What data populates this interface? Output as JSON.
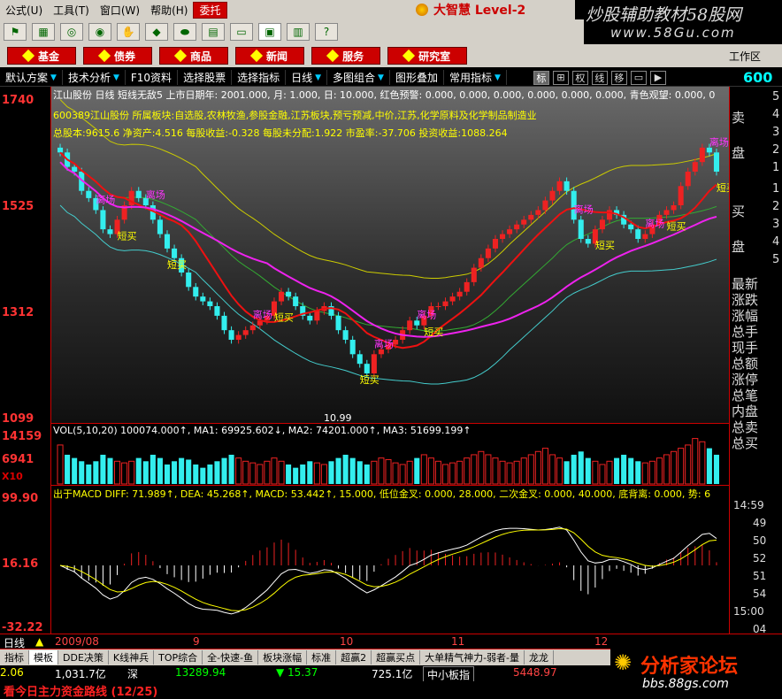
{
  "menu": {
    "items": [
      "公式(U)",
      "工具(T)",
      "窗口(W)",
      "帮助(H)",
      "委托"
    ]
  },
  "brand": {
    "name": "大智慧 Level-2"
  },
  "watermark": {
    "line1": "炒股辅助教材58股网",
    "line2": "www.58Gu.com"
  },
  "nav": {
    "buttons": [
      "基金",
      "债券",
      "商品",
      "新闻",
      "服务",
      "研究室"
    ],
    "workarea": "工作区"
  },
  "funcbar": {
    "items": [
      "默认方案",
      "技术分析",
      "F10资料",
      "选择股票",
      "选择指标",
      "日线",
      "多图组合",
      "图形叠加",
      "常用指标"
    ],
    "keys": [
      "标",
      "⊞",
      "权",
      "线",
      "移",
      "▭",
      "▶"
    ],
    "price": "600"
  },
  "chart": {
    "header": "江山股份 日线 短线无敌5  上市日期年: 2001.000, 月: 1.000, 日: 10.000, 红色预警: 0.000, 0.000, 0.000, 0.000, 0.000, 0.000, 青色观望: 0.000, 0",
    "info1": "600389江山股份 所属板块:自选股,农林牧渔,参股金融,江苏板块,预亏预减,中价,江苏,化学原料及化学制品制造业",
    "info2": "总股本:9615.6 净资产:4.516 每股收益:-0.328 每股未分配:1.922 市盈率:-37.706 投资收益:1088.264",
    "y_labels": [
      "1740",
      "1525",
      "1312",
      "1099"
    ],
    "low_label": "10.99",
    "signal_buy": "短买",
    "signal_sell": "离场"
  },
  "volume": {
    "header": "VOL(5,10,20)  100074.000↑, MA1: 69925.602↓, MA2: 74201.000↑, MA3: 51699.199↑",
    "y_labels": [
      "14159",
      "6941"
    ],
    "unit": "X10"
  },
  "macd": {
    "header": "出于MACD  DIFF: 71.989↑, DEA: 45.268↑, MACD: 53.442↑, 15.000, 低位金叉: 0.000, 28.000, 二次金叉: 0.000, 40.000, 底背离: 0.000, 势: 6",
    "y_labels": [
      "99.90",
      "16.16",
      "-32.22"
    ]
  },
  "right": {
    "sell": [
      "卖",
      "盘"
    ],
    "buy": [
      "买",
      "盘"
    ],
    "sell_nums": [
      "5",
      "4",
      "3",
      "2",
      "1"
    ],
    "buy_nums": [
      "1",
      "2",
      "3",
      "4",
      "5"
    ],
    "stats": [
      "最新",
      "涨跌",
      "涨幅",
      "总手",
      "现手",
      "总额",
      "涨停",
      "总笔",
      "内盘",
      "总卖",
      "总买"
    ],
    "times": [
      "14:59",
      "49",
      "50",
      "52",
      "51",
      "54",
      "15:00",
      "04"
    ]
  },
  "timeaxis": {
    "label": "日线",
    "ticks": [
      "2009/08",
      "9",
      "10",
      "11",
      "12"
    ]
  },
  "tabs": [
    "指标",
    "模板",
    "DDE决策",
    "K线神兵",
    "TOP综合",
    "全-快速-鱼",
    "板块涨幅",
    "标准",
    "超赢2",
    "超赢买点",
    "大单精气神力-弱者-量",
    "龙龙"
  ],
  "status": {
    "v1": "2.06",
    "v2": "1,031.7亿",
    "v3": "深",
    "v4": "13289.94",
    "v5": "▼ 15.37",
    "v6": "725.1亿",
    "v7": "中小板指",
    "v8": "5448.97"
  },
  "ticker": "看今日主力资金路线 (12/25)",
  "forum": {
    "name": "分析家论坛",
    "url": "bbs.88gs.com"
  },
  "chart_data": {
    "type": "candlestick",
    "ylim": [
      1099,
      1740
    ],
    "close": [
      1640,
      1610,
      1600,
      1560,
      1545,
      1520,
      1480,
      1470,
      1500,
      1530,
      1560,
      1545,
      1530,
      1500,
      1470,
      1440,
      1420,
      1390,
      1360,
      1340,
      1330,
      1320,
      1300,
      1270,
      1250,
      1260,
      1270,
      1280,
      1290,
      1300,
      1330,
      1350,
      1340,
      1320,
      1300,
      1290,
      1310,
      1320,
      1300,
      1270,
      1250,
      1220,
      1200,
      1180,
      1220,
      1230,
      1240,
      1250,
      1270,
      1290,
      1280,
      1300,
      1320,
      1320,
      1330,
      1340,
      1350,
      1370,
      1400,
      1420,
      1440,
      1460,
      1470,
      1480,
      1490,
      1500,
      1510,
      1520,
      1540,
      1560,
      1580,
      1560,
      1500,
      1460,
      1450,
      1480,
      1500,
      1520,
      1510,
      1490,
      1480,
      1460,
      1470,
      1490,
      1510,
      1520,
      1530,
      1570,
      1600,
      1620,
      1650,
      1640,
      1600
    ],
    "vol": [
      12000,
      9000,
      8000,
      7000,
      6000,
      7000,
      9000,
      8000,
      7000,
      6500,
      7000,
      8000,
      7000,
      9000,
      8000,
      6000,
      7000,
      8000,
      7500,
      6000,
      5000,
      6000,
      7000,
      8000,
      9000,
      8000,
      7000,
      6500,
      6000,
      7000,
      8000,
      7000,
      6000,
      5000,
      6000,
      7000,
      6500,
      6000,
      7000,
      8000,
      9000,
      8000,
      7000,
      6000,
      7000,
      8000,
      7500,
      6500,
      6000,
      7000,
      8000,
      9000,
      8000,
      7000,
      6000,
      6500,
      7000,
      8000,
      9000,
      10000,
      9000,
      8000,
      7000,
      6500,
      7000,
      8000,
      9000,
      10000,
      11000,
      9000,
      8000,
      7000,
      9000,
      10000,
      8000,
      7000,
      6000,
      7000,
      8000,
      9000,
      8000,
      7000,
      6500,
      7000,
      8000,
      9000,
      10000,
      11000,
      12000,
      14000,
      13000,
      11000,
      9000
    ]
  }
}
